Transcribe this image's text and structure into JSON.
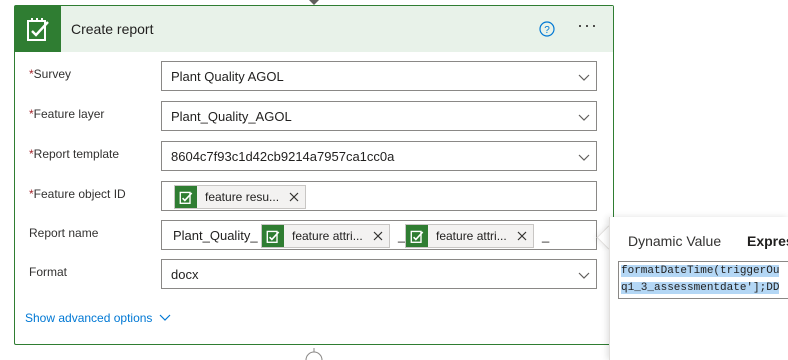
{
  "card": {
    "title": "Create report",
    "app_icon": "survey123-checklist-icon",
    "help_icon": "help-circle-icon",
    "more_label": "···",
    "accent_color": "#2f7d32",
    "header_bg": "#e8f2e9"
  },
  "fields": {
    "survey": {
      "label": "Survey",
      "required": "*",
      "value": "Plant Quality AGOL"
    },
    "feature_layer": {
      "label": "Feature layer",
      "required": "*",
      "value": "Plant_Quality_AGOL"
    },
    "report_template": {
      "label": "Report template",
      "required": "*",
      "value": "8604c7f93c1d42cb9214a7957ca1cc0a"
    },
    "feature_object_id": {
      "label": "Feature object ID",
      "required": "*",
      "token": "feature resu..."
    },
    "report_name": {
      "label": "Report name",
      "prefix": "Plant_Quality_",
      "token1": "feature attri...",
      "separator": "_",
      "token2": "feature attri...",
      "suffix": "_"
    },
    "format": {
      "label": "Format",
      "value": "docx"
    }
  },
  "advanced": {
    "label": "Show advanced options"
  },
  "side_panel": {
    "tabs": [
      "Dynamic Value",
      "Expres"
    ],
    "active_tab": "Expres",
    "expression_lines": [
      "formatDateTime(triggerOu",
      "q1_3_assessmentdate'];DD"
    ]
  }
}
